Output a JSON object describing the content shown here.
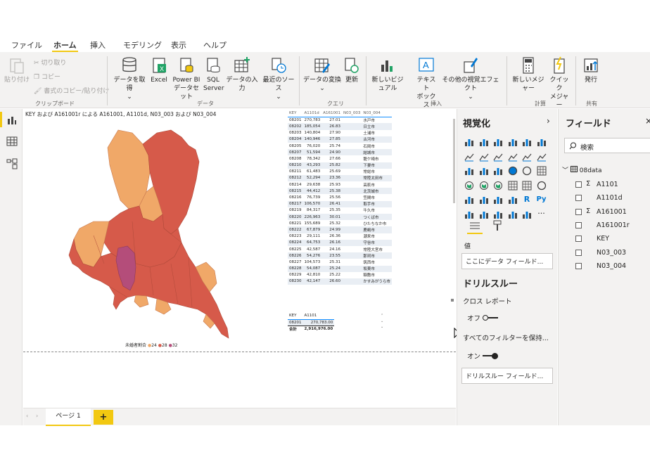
{
  "menu": {
    "file": "ファイル",
    "home": "ホーム",
    "insert": "挿入",
    "modeling": "モデリング",
    "view": "表示",
    "help": "ヘルプ"
  },
  "ribbon": {
    "paste": "貼り付け",
    "cut": "切り取り",
    "copy": "コピー",
    "format_painter": "書式のコピー/貼り付け",
    "clipboard_group": "クリップボード",
    "get_data": "データを取得",
    "excel": "Excel",
    "pbi_dataset_1": "Power BI",
    "pbi_dataset_2": "データセット",
    "sql_1": "SQL",
    "sql_2": "Server",
    "enter_data": "データの入力",
    "recent_sources": "最近のソース",
    "data_group": "データ",
    "transform": "データの変換",
    "refresh": "更新",
    "query_group": "クエリ",
    "new_visual": "新しいビジュアル",
    "textbox_1": "テキスト",
    "textbox_2": "ボックス",
    "more_visuals": "その他の視覚エフェクト",
    "insert_group": "挿入",
    "new_measure": "新しいメジャー",
    "quick_measure_1": "クイック",
    "quick_measure_2": "メジャー",
    "calc_group": "計算",
    "publish": "発行",
    "share_group": "共有"
  },
  "visual": {
    "title": "KEY および A161001r による A161001, A1101d, N03_003 および N03_004",
    "legend_title": "未婚者割合",
    "legend_items": [
      {
        "label": "24",
        "color": "#f0a868"
      },
      {
        "label": "28",
        "color": "#d65a4a"
      },
      {
        "label": "32",
        "color": "#b44d7a"
      }
    ]
  },
  "table1": {
    "headers": [
      "KEY",
      "A1101d",
      "A161001",
      "N03_003",
      "N03_004"
    ],
    "rows": [
      [
        "08201",
        "270,783",
        "27.01",
        "",
        "水戸市"
      ],
      [
        "08202",
        "185,054",
        "26.83",
        "",
        "日立市"
      ],
      [
        "08203",
        "140,804",
        "27.90",
        "",
        "土浦市"
      ],
      [
        "08204",
        "140,946",
        "27.85",
        "",
        "古河市"
      ],
      [
        "08205",
        "76,020",
        "25.74",
        "",
        "石岡市"
      ],
      [
        "08207",
        "51,594",
        "24.90",
        "",
        "結城市"
      ],
      [
        "08208",
        "78,342",
        "27.66",
        "",
        "龍ケ崎市"
      ],
      [
        "08210",
        "43,293",
        "25.82",
        "",
        "下妻市"
      ],
      [
        "08211",
        "61,483",
        "25.69",
        "",
        "常総市"
      ],
      [
        "08212",
        "52,294",
        "23.36",
        "",
        "常陸太田市"
      ],
      [
        "08214",
        "29,638",
        "25.93",
        "",
        "高萩市"
      ],
      [
        "08215",
        "44,412",
        "25.38",
        "",
        "北茨城市"
      ],
      [
        "08216",
        "76,739",
        "25.56",
        "",
        "笠間市"
      ],
      [
        "08217",
        "106,570",
        "26.41",
        "",
        "取手市"
      ],
      [
        "08219",
        "84,317",
        "25.35",
        "",
        "牛久市"
      ],
      [
        "08220",
        "226,963",
        "30.01",
        "",
        "つくば市"
      ],
      [
        "08221",
        "155,689",
        "25.32",
        "",
        "ひたちなか市"
      ],
      [
        "08222",
        "67,879",
        "24.99",
        "",
        "鹿嶋市"
      ],
      [
        "08223",
        "29,111",
        "26.36",
        "",
        "潮来市"
      ],
      [
        "08224",
        "64,753",
        "26.16",
        "",
        "守谷市"
      ],
      [
        "08225",
        "42,587",
        "24.16",
        "",
        "常陸大宮市"
      ],
      [
        "08226",
        "54,276",
        "23.55",
        "",
        "那珂市"
      ],
      [
        "08227",
        "104,573",
        "25.31",
        "",
        "筑西市"
      ],
      [
        "08228",
        "54,087",
        "25.24",
        "",
        "坂東市"
      ],
      [
        "08229",
        "42,810",
        "25.22",
        "",
        "稲敷市"
      ],
      [
        "08230",
        "42,147",
        "26.60",
        "",
        "かすみがうら市"
      ]
    ]
  },
  "table2": {
    "headers": [
      "KEY",
      "A1101"
    ],
    "rows": [
      [
        "08201",
        "270,783.00"
      ]
    ],
    "total_label": "合計",
    "total_value": "2,916,976.00"
  },
  "page_tab": "ページ 1",
  "add_page": "+",
  "viz_pane": {
    "title": "視覚化",
    "values_label": "値",
    "add_field": "ここにデータ フィールド...",
    "drillthrough": "ドリルスルー",
    "cross_report": "クロス レポート",
    "off": "オフ",
    "keep_filters": "すべてのフィルターを保持...",
    "on": "オン",
    "drill_fields": "ドリルスルー フィールド..."
  },
  "fields_pane": {
    "title": "フィールド",
    "search_placeholder": "検索",
    "table": "08data",
    "fields": [
      {
        "name": "A1101",
        "sigma": true
      },
      {
        "name": "A1101d",
        "sigma": false
      },
      {
        "name": "A161001",
        "sigma": true
      },
      {
        "name": "A161001r",
        "sigma": false
      },
      {
        "name": "KEY",
        "sigma": false
      },
      {
        "name": "N03_003",
        "sigma": false
      },
      {
        "name": "N03_004",
        "sigma": false
      }
    ]
  },
  "colors": {
    "accent": "#f2c811",
    "orange": "#f0a868",
    "red": "#d65a4a",
    "purple": "#b44d7a"
  }
}
